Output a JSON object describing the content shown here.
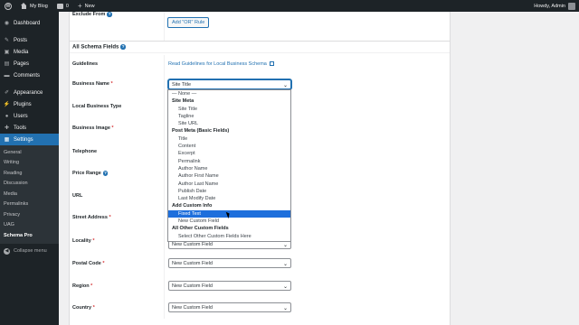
{
  "adminbar": {
    "site_name": "My Blog",
    "comments_count": "0",
    "new_label": "New",
    "greeting": "Howdy, Admin"
  },
  "sidebar": {
    "items": [
      {
        "label": "Dashboard",
        "icon": "dashboard-icon"
      },
      {
        "label": "Posts",
        "icon": "pin-icon"
      },
      {
        "label": "Media",
        "icon": "media-icon"
      },
      {
        "label": "Pages",
        "icon": "page-icon"
      },
      {
        "label": "Comments",
        "icon": "comment-icon"
      },
      {
        "label": "Appearance",
        "icon": "brush-icon"
      },
      {
        "label": "Plugins",
        "icon": "plug-icon"
      },
      {
        "label": "Users",
        "icon": "user-icon"
      },
      {
        "label": "Tools",
        "icon": "wrench-icon"
      },
      {
        "label": "Settings",
        "icon": "settings-icon"
      }
    ],
    "submenu": [
      "General",
      "Writing",
      "Reading",
      "Discussion",
      "Media",
      "Permalinks",
      "Privacy",
      "UAG",
      "Schema Pro"
    ],
    "collapse_label": "Collapse menu"
  },
  "form": {
    "exclude_from_label": "Exclude From",
    "add_or_rule": "Add \"OR\" Rule",
    "section_title": "All Schema Fields",
    "guidelines_label": "Guidelines",
    "guidelines_link": "Read Guidelines for Local Business Schema",
    "fields": [
      {
        "label": "Business Name",
        "required": true,
        "value": "Site Title"
      },
      {
        "label": "Local Business Type",
        "required": false
      },
      {
        "label": "Business Image",
        "required": true
      },
      {
        "label": "Telephone",
        "required": false
      },
      {
        "label": "Price Range",
        "required": false,
        "help": true
      },
      {
        "label": "URL",
        "required": false
      },
      {
        "label": "Street Address",
        "required": true
      },
      {
        "label": "Locality",
        "required": true,
        "value": "New Custom Field"
      },
      {
        "label": "Postal Code",
        "required": true,
        "value": "New Custom Field"
      },
      {
        "label": "Region",
        "required": true,
        "value": "New Custom Field"
      },
      {
        "label": "Country",
        "required": true,
        "value": "New Custom Field"
      }
    ],
    "required_mark": "*"
  },
  "dropdown": {
    "options": [
      {
        "text": "— None —",
        "kind": "none"
      },
      {
        "text": "Site Meta",
        "kind": "group"
      },
      {
        "text": "Site Title",
        "kind": "option"
      },
      {
        "text": "Tagline",
        "kind": "option"
      },
      {
        "text": "Site URL",
        "kind": "option"
      },
      {
        "text": "Post Meta (Basic Fields)",
        "kind": "group"
      },
      {
        "text": "Title",
        "kind": "option"
      },
      {
        "text": "Content",
        "kind": "option"
      },
      {
        "text": "Excerpt",
        "kind": "option"
      },
      {
        "text": "Permalink",
        "kind": "option"
      },
      {
        "text": "Author Name",
        "kind": "option"
      },
      {
        "text": "Author First Name",
        "kind": "option"
      },
      {
        "text": "Author Last Name",
        "kind": "option"
      },
      {
        "text": "Publish Date",
        "kind": "option"
      },
      {
        "text": "Last Modify Date",
        "kind": "option"
      },
      {
        "text": "Add Custom Info",
        "kind": "group"
      },
      {
        "text": "Fixed Text",
        "kind": "option",
        "highlighted": true
      },
      {
        "text": "New Custom Field",
        "kind": "option"
      },
      {
        "text": "All Other Custom Fields",
        "kind": "group"
      },
      {
        "text": "Select Other Custom Fields Here",
        "kind": "option"
      }
    ]
  },
  "colors": {
    "admin_dark": "#1d2327",
    "accent": "#2271b1",
    "highlight": "#1e6fdc",
    "required": "#d63638"
  }
}
